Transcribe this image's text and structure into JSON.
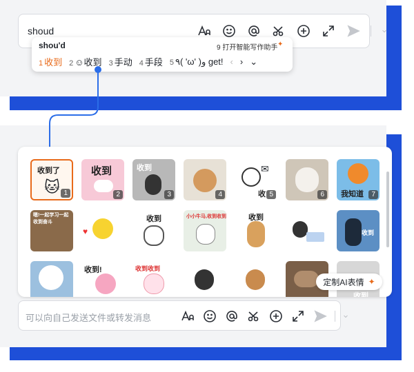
{
  "colors": {
    "accent_blue": "#1e4fd8",
    "candidate_orange": "#e86a1a",
    "arrow_blue": "#2b6de8"
  },
  "top_input": {
    "text": "shoud"
  },
  "candidates": {
    "composition": "shou'd",
    "assistant_label": "9 打开智能写作助手",
    "items": [
      {
        "num": "1",
        "text": "收到",
        "active": true
      },
      {
        "num": "2",
        "text": "收到",
        "emoji": "smile-icon"
      },
      {
        "num": "3",
        "text": "手动"
      },
      {
        "num": "4",
        "text": "手段"
      },
      {
        "num": "5",
        "text": "٩( 'ω' )و get!"
      }
    ]
  },
  "stickers": [
    {
      "num": "1",
      "caption": "收到了"
    },
    {
      "num": "2",
      "caption": "收到"
    },
    {
      "num": "3",
      "caption": "收到"
    },
    {
      "num": "4",
      "caption": ""
    },
    {
      "num": "5",
      "caption": "收"
    },
    {
      "num": "6",
      "caption": ""
    },
    {
      "num": "7",
      "caption": "我知道"
    },
    {
      "caption": "嗯!一起学习一起收到奋斗"
    },
    {
      "caption": ""
    },
    {
      "caption": "收到"
    },
    {
      "caption": "小小牛马,收到收到"
    },
    {
      "caption": "收到"
    },
    {
      "caption": ""
    },
    {
      "caption": "收到"
    },
    {
      "caption": ""
    },
    {
      "caption": "收到!"
    },
    {
      "caption": "收到收到"
    },
    {
      "caption": ""
    },
    {
      "caption": ""
    },
    {
      "caption": ""
    },
    {
      "caption": "收到"
    }
  ],
  "ai_chip": {
    "label": "定制AI表情"
  },
  "bottom_input": {
    "placeholder": "可以向自己发送文件或转发消息"
  },
  "toolbar_icons": [
    "font-size-icon",
    "emoji-icon",
    "mention-icon",
    "scissors-icon",
    "add-icon",
    "expand-icon",
    "send-icon",
    "chevron-down-icon"
  ]
}
